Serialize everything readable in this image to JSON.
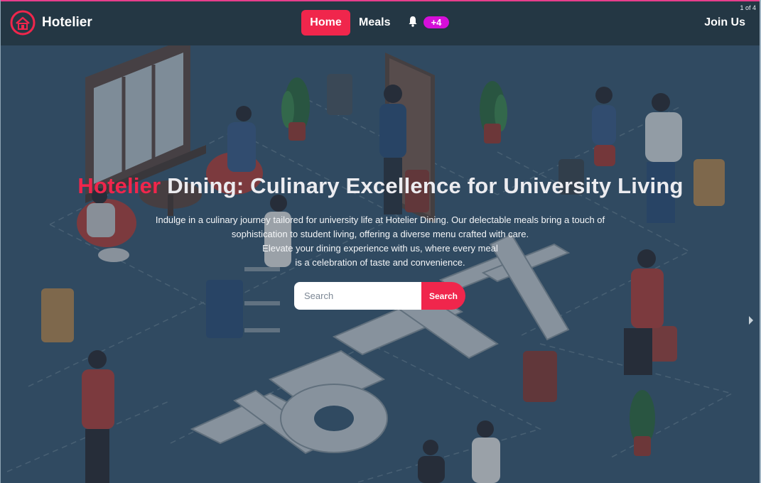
{
  "navbar": {
    "brand_name": "Hotelier",
    "logo_icon": "hotel-logo-icon",
    "home_label": "Home",
    "meals_label": "Meals",
    "notification_icon": "bell-icon",
    "notification_count": "+4",
    "join_label": "Join Us"
  },
  "carousel": {
    "indicator": "1 of 4",
    "next_icon": "chevron-right-icon"
  },
  "hero": {
    "title_accent": "Hotelier",
    "title_rest": " Dining: Culinary Excellence for University Living",
    "description_lines": [
      "Indulge in a culinary journey tailored for university life at Hotelier Dining. Our delectable meals bring a touch of",
      "sophistication to student living, offering a diverse menu crafted with care.",
      "Elevate your dining experience with us, where every meal",
      "is a celebration of taste and convenience."
    ],
    "search": {
      "placeholder": "Search",
      "value": "",
      "button_label": "Search"
    }
  },
  "colors": {
    "accent": "#f0264c",
    "badge": "#d50fd9",
    "navbar": "#243744",
    "hero_background": "#3b5a73"
  }
}
